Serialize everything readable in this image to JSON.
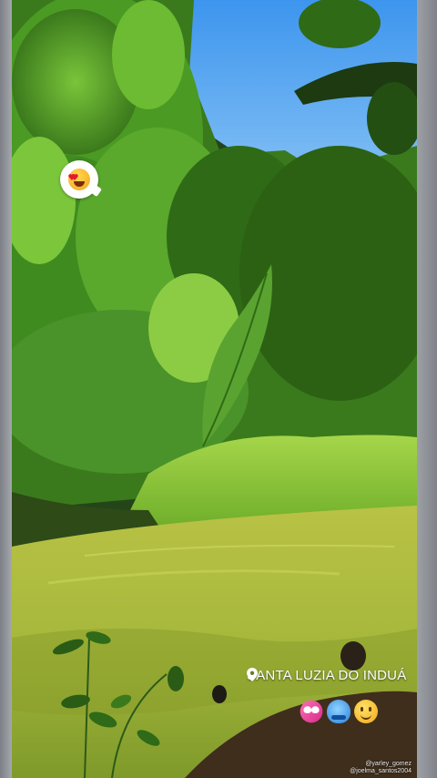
{
  "story": {
    "reaction_emoji": "heart-eyes-face",
    "location": {
      "icon": "pin-icon",
      "label": "SANTA LUZIA DO INDUÁ"
    },
    "stickers": [
      "smiling-face-with-hearts",
      "blue-face",
      "smiling-face"
    ],
    "credits": [
      "@yarley_gomez",
      "@joelma_santos2004"
    ]
  },
  "colors": {
    "frame": "#8f949a",
    "sky": "#4aa3f0",
    "foliage": "#3e8a1e",
    "grass": "#8dc93a",
    "water": "#a3b83a",
    "text": "#ffffff"
  }
}
